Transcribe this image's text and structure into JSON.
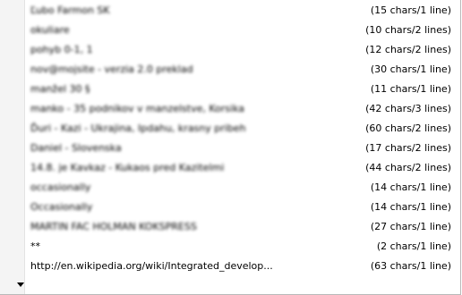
{
  "items": [
    {
      "text": "Ľubo Farmon SK",
      "info": "(15 chars/1 line)"
    },
    {
      "text": "okuliare",
      "info": "(10 chars/2 lines)"
    },
    {
      "text": "pohyb 0-1, 1",
      "info": "(12 chars/2 lines)"
    },
    {
      "text": "nov@mojsite - verzia 2.0 preklad",
      "info": "(30 chars/1 line)"
    },
    {
      "text": "manžel 30 §",
      "info": "(11 chars/1 line)"
    },
    {
      "text": "manko - 35 podnikov v manzelstve, Korsika",
      "info": "(42 chars/3 lines)"
    },
    {
      "text": "Ďuri - Kazi - Ukrajina, Ipdahu, krasny pribeh",
      "info": "(60 chars/2 lines)"
    },
    {
      "text": "Daniel - Slovenska",
      "info": "(17 chars/2 lines)"
    },
    {
      "text": "14.8. je Kavkaz - Kukaos pred Kazitelmi",
      "info": "(44 chars/2 lines)"
    },
    {
      "text": "occasionally",
      "info": "(14 chars/1 line)"
    },
    {
      "text": "Occasionally",
      "info": "(14 chars/1 line)"
    },
    {
      "text": "MARTIN FAC HOLMAN KOKSPRESS",
      "info": "(27 chars/1 line)"
    },
    {
      "text": "**",
      "info": "(2 chars/1 line)"
    },
    {
      "text": "http://en.wikipedia.org/wiki/Integrated_develop...",
      "info": "(63 chars/1 line)"
    }
  ]
}
